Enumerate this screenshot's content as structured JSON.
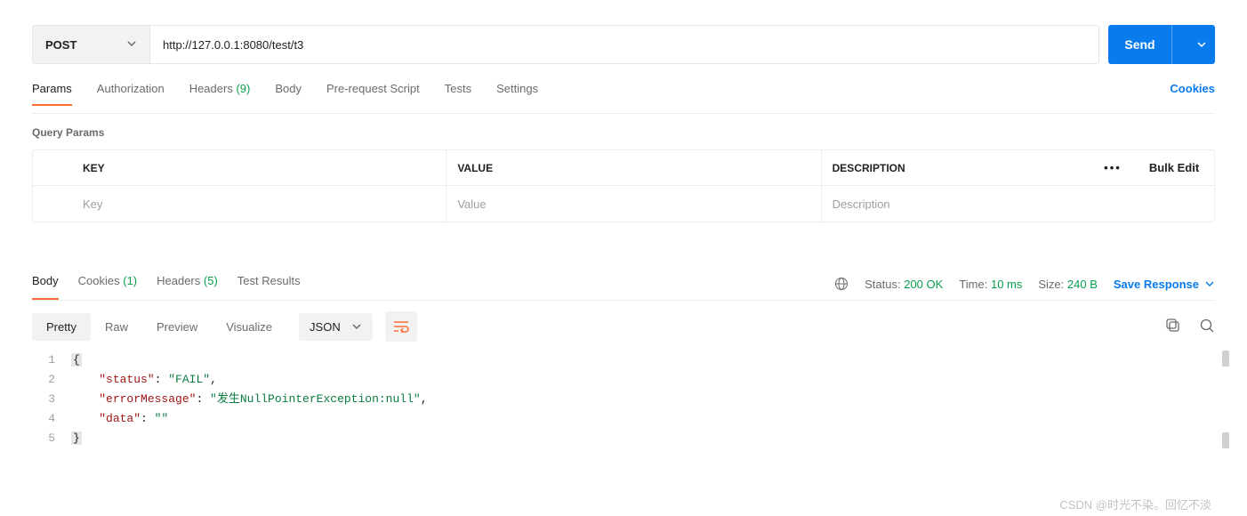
{
  "request": {
    "method": "POST",
    "url": "http://127.0.0.1:8080/test/t3",
    "send_label": "Send"
  },
  "tabs": {
    "params": "Params",
    "authorization": "Authorization",
    "headers": "Headers",
    "headers_count": "(9)",
    "body": "Body",
    "pre_request": "Pre-request Script",
    "tests": "Tests",
    "settings": "Settings",
    "cookies": "Cookies"
  },
  "query_params": {
    "title": "Query Params",
    "key_header": "KEY",
    "value_header": "VALUE",
    "desc_header": "DESCRIPTION",
    "bulk_edit": "Bulk Edit",
    "key_placeholder": "Key",
    "value_placeholder": "Value",
    "desc_placeholder": "Description"
  },
  "response": {
    "tabs": {
      "body": "Body",
      "cookies": "Cookies",
      "cookies_count": "(1)",
      "headers": "Headers",
      "headers_count": "(5)",
      "test_results": "Test Results"
    },
    "status_label": "Status:",
    "status_value": "200 OK",
    "time_label": "Time:",
    "time_value": "10 ms",
    "size_label": "Size:",
    "size_value": "240 B",
    "save_response": "Save Response",
    "view": {
      "pretty": "Pretty",
      "raw": "Raw",
      "preview": "Preview",
      "visualize": "Visualize",
      "format": "JSON"
    },
    "body_lines": [
      {
        "n": "1",
        "content": [
          {
            "t": "brace",
            "v": "{"
          }
        ]
      },
      {
        "n": "2",
        "content": [
          {
            "t": "indent",
            "v": "    "
          },
          {
            "t": "key",
            "v": "\"status\""
          },
          {
            "t": "punct",
            "v": ": "
          },
          {
            "t": "str",
            "v": "\"FAIL\""
          },
          {
            "t": "punct",
            "v": ","
          }
        ]
      },
      {
        "n": "3",
        "content": [
          {
            "t": "indent",
            "v": "    "
          },
          {
            "t": "key",
            "v": "\"errorMessage\""
          },
          {
            "t": "punct",
            "v": ": "
          },
          {
            "t": "str",
            "v": "\"发生NullPointerException:null\""
          },
          {
            "t": "punct",
            "v": ","
          }
        ]
      },
      {
        "n": "4",
        "content": [
          {
            "t": "indent",
            "v": "    "
          },
          {
            "t": "key",
            "v": "\"data\""
          },
          {
            "t": "punct",
            "v": ": "
          },
          {
            "t": "str",
            "v": "\"\""
          }
        ]
      },
      {
        "n": "5",
        "content": [
          {
            "t": "brace",
            "v": "}"
          }
        ]
      }
    ]
  },
  "watermark": "CSDN @时光不染。回忆不淡"
}
